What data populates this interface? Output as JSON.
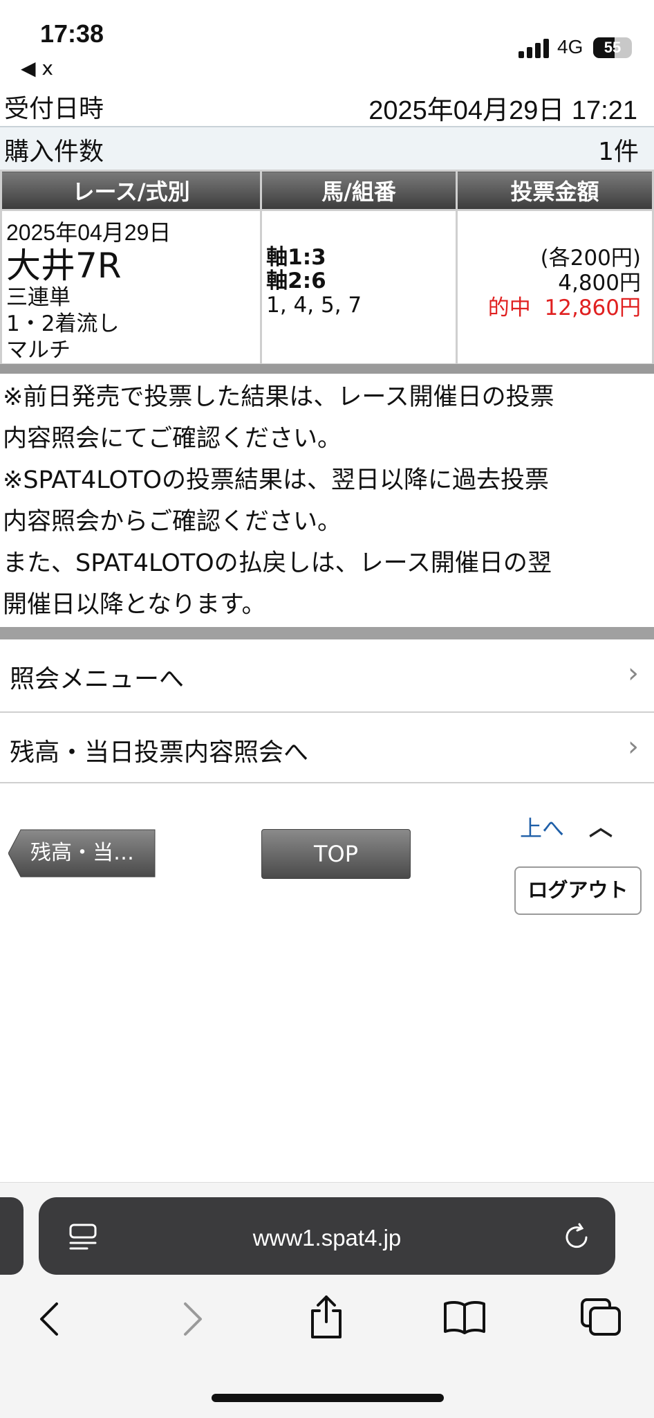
{
  "status": {
    "time": "17:38",
    "network": "4G",
    "battery": "55",
    "back_label": "◀ x"
  },
  "info": {
    "reception_label": "受付日時",
    "reception_value": "2025年04月29日 17:21",
    "count_label": "購入件数",
    "count_value": "1件"
  },
  "table": {
    "headers": [
      "レース/式別",
      "馬/組番",
      "投票金額"
    ],
    "date": "2025年04月29日",
    "race": "大井7R",
    "type": "三連単",
    "method": "1・2着流し",
    "multi": "マルチ",
    "axis1": "軸1:3",
    "axis2": "軸2:6",
    "horses": "1, 4, 5, 7",
    "unit_amount": "(各200円)",
    "total_amount": "4,800円",
    "hit_label": "的中",
    "hit_amount": "12,860円"
  },
  "notes": [
    "※前日発売で投票した結果は、レース開催日の投票",
    "内容照会にてご確認ください。",
    "※SPAT4LOTOの投票結果は、翌日以降に過去投票",
    "内容照会からご確認ください。",
    "また、SPAT4LOTOの払戻しは、レース開催日の翌",
    "開催日以降となります。"
  ],
  "menu": [
    {
      "label": "照会メニューへ"
    },
    {
      "label": "残高・当日投票内容照会へ"
    }
  ],
  "buttons": {
    "back": "残高・当…",
    "top": "TOP",
    "up": "上へ",
    "logout": "ログアウト"
  },
  "browser": {
    "url": "www1.spat4.jp"
  },
  "colors": {
    "hit": "#e02020",
    "link": "#1f5fa8",
    "header_dark": "#3c3c3c"
  }
}
